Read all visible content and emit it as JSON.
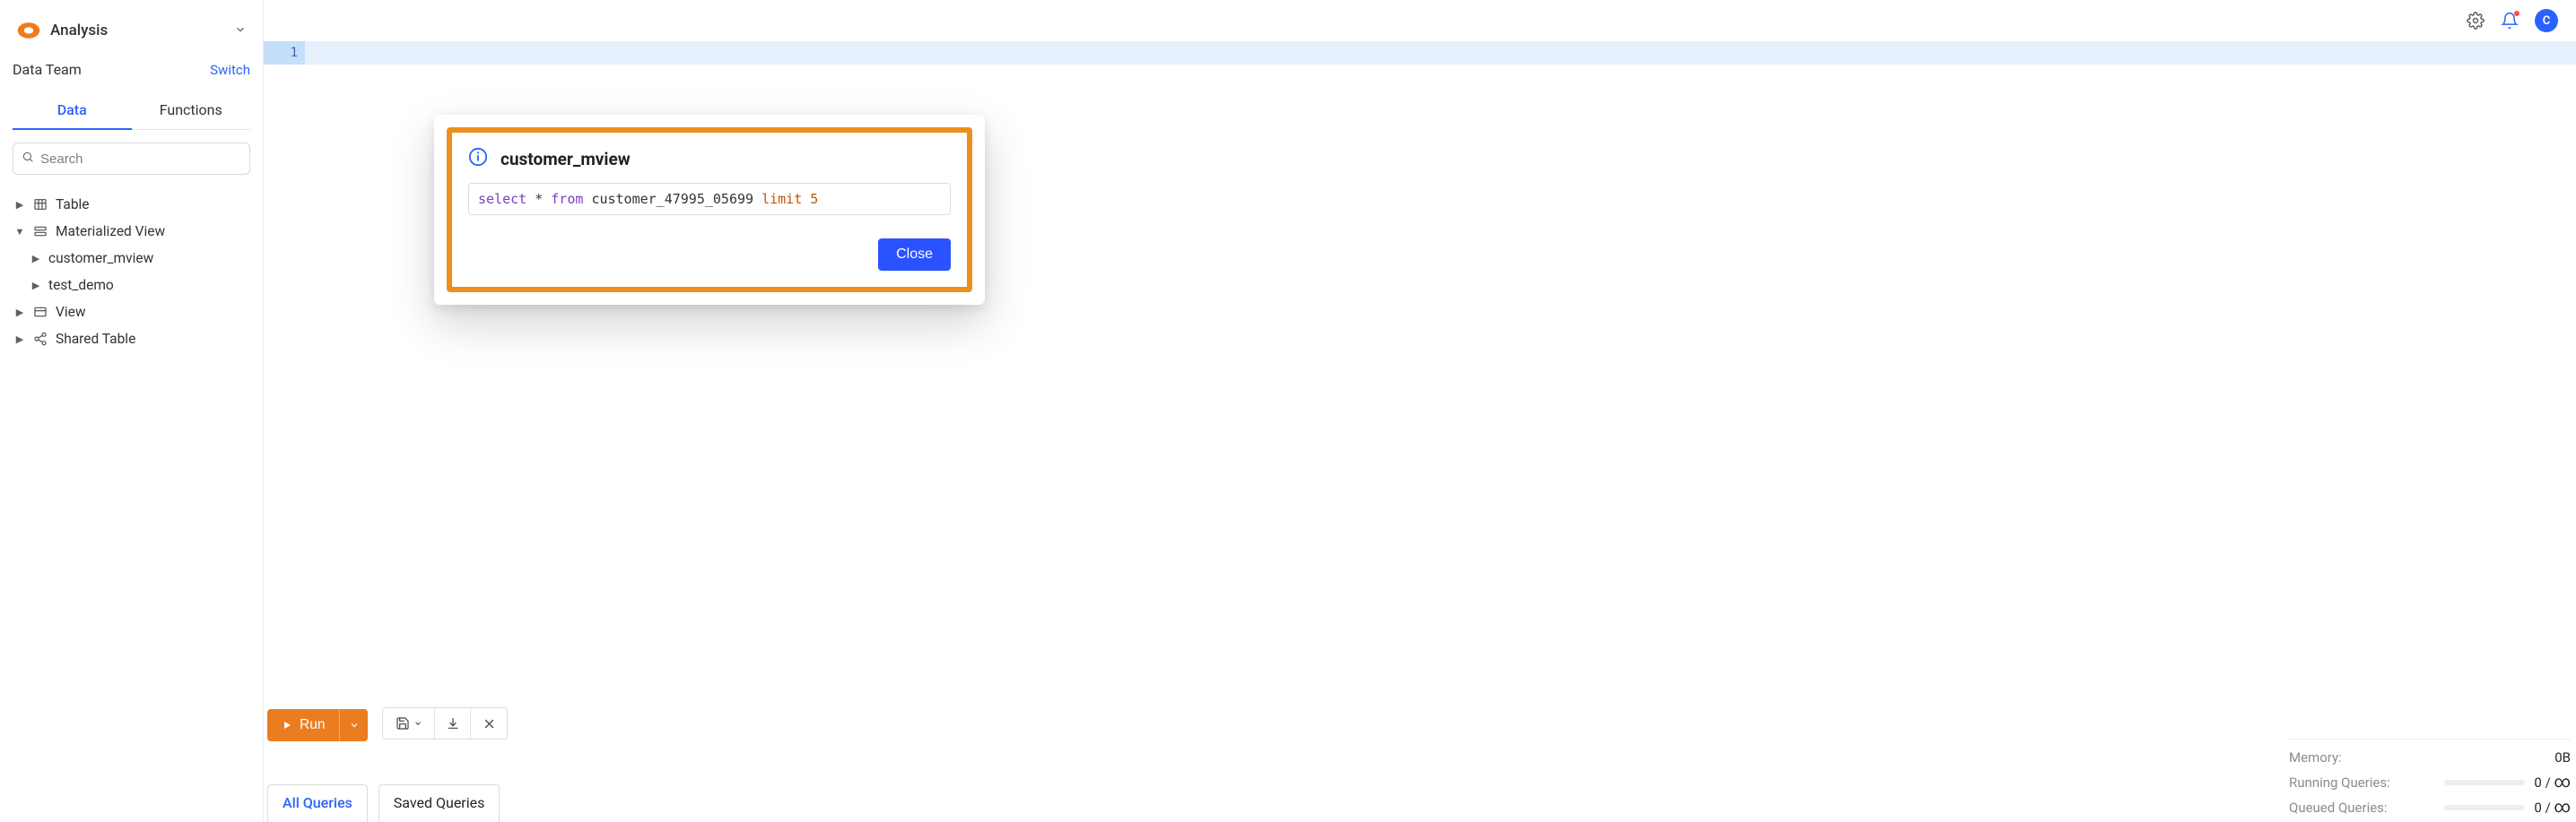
{
  "sidebar": {
    "section_title": "Analysis",
    "team_label": "Data Team",
    "switch_label": "Switch",
    "tabs": {
      "data": "Data",
      "functions": "Functions"
    },
    "search_placeholder": "Search",
    "tree": {
      "table": "Table",
      "mview": "Materialized View",
      "mview_children": [
        "customer_mview",
        "test_demo"
      ],
      "view": "View",
      "shared_table": "Shared Table"
    }
  },
  "topbar": {
    "avatar_initial": "C"
  },
  "editor": {
    "line_numbers": [
      "1"
    ]
  },
  "modal": {
    "title": "customer_mview",
    "sql": {
      "select": "select",
      "star": "*",
      "from": "from",
      "table_name": "customer_47995_05699",
      "limit": "limit",
      "limit_value": "5"
    },
    "close_label": "Close"
  },
  "toolbar": {
    "run_label": "Run"
  },
  "query_tabs": {
    "all": "All Queries",
    "saved": "Saved Queries"
  },
  "status": {
    "memory_label": "Memory:",
    "memory_value": "0B",
    "running_label": "Running Queries:",
    "running_value": "0 / ",
    "running_inf": "∞",
    "queued_label": "Queued Queries:",
    "queued_value": "0 / ",
    "queued_inf": "∞"
  }
}
